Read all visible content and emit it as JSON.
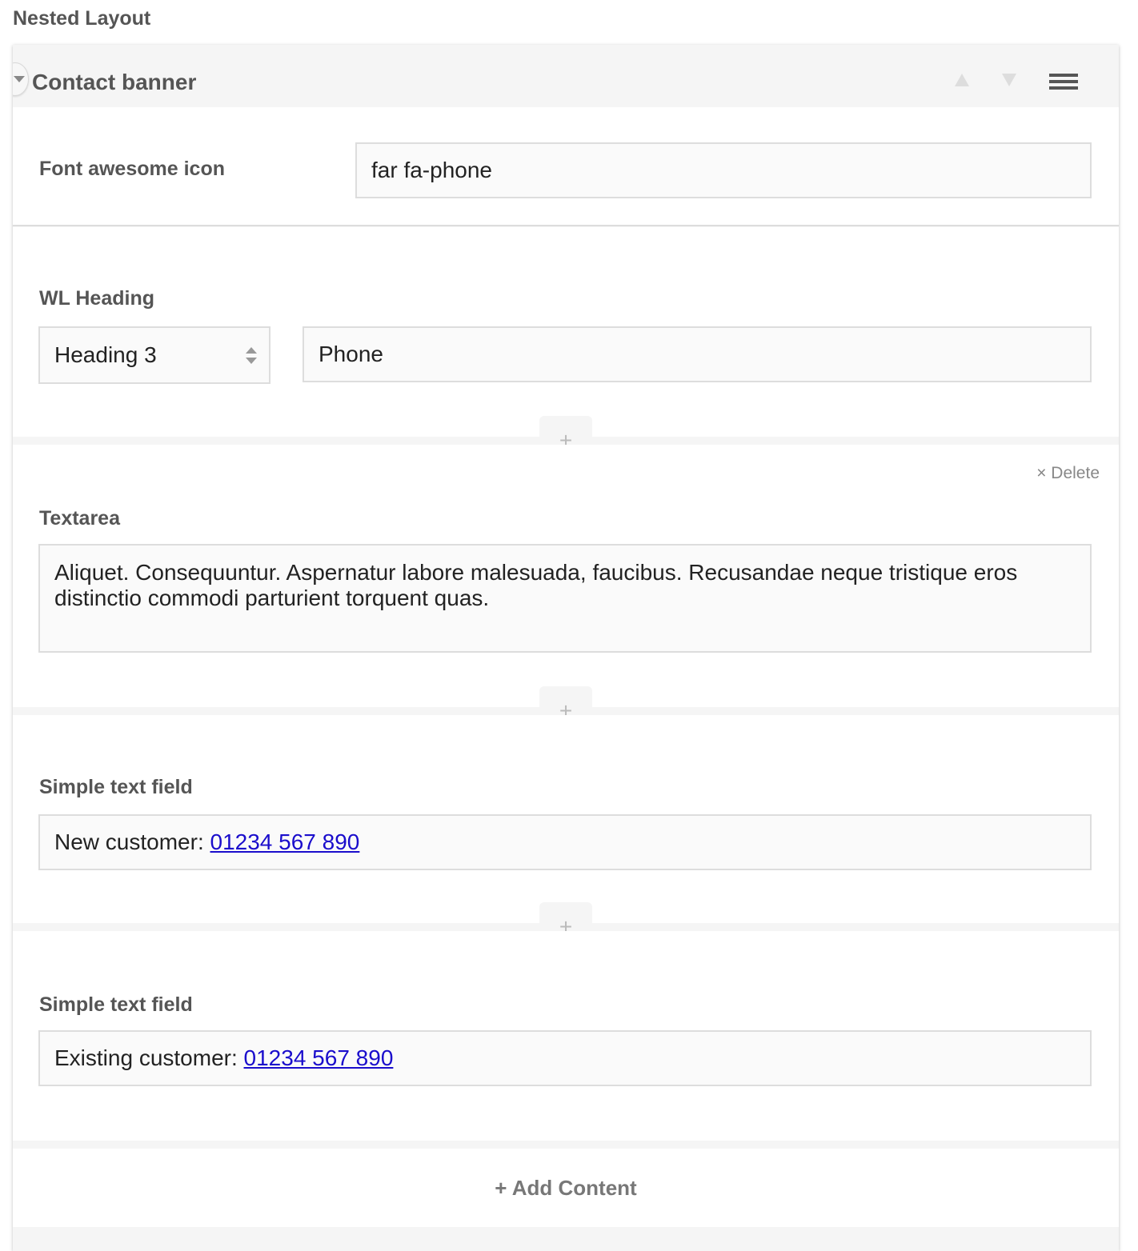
{
  "page": {
    "title": "Nested Layout"
  },
  "panel": {
    "title": "Contact banner"
  },
  "fields": {
    "icon": {
      "label": "Font awesome icon",
      "value": "far fa-phone"
    },
    "heading": {
      "label": "WL Heading",
      "level": "Heading 3",
      "value": "Phone"
    },
    "textarea": {
      "label": "Textarea",
      "value": "Aliquet. Consequuntur. Aspernatur labore malesuada, faucibus. Recusandae neque tristique eros distinctio commodi parturient torquent quas.",
      "delete_label": "Delete",
      "delete_symbol": "×"
    },
    "simple1": {
      "label": "Simple text field",
      "prefix": "New customer: ",
      "link": "01234 567 890"
    },
    "simple2": {
      "label": "Simple text field",
      "prefix": "Existing customer: ",
      "link": "01234 567 890"
    }
  },
  "insert_symbol": "+",
  "add_content_label": "+ Add Content",
  "colors": {
    "link": "#1a0dcc",
    "panel_bg": "#f5f5f5",
    "border": "#dddddd",
    "label": "#555555"
  },
  "icons": [
    "chevron-down-icon",
    "arrow-up-icon",
    "arrow-down-icon",
    "hamburger-menu-icon",
    "plus-icon",
    "close-icon"
  ]
}
